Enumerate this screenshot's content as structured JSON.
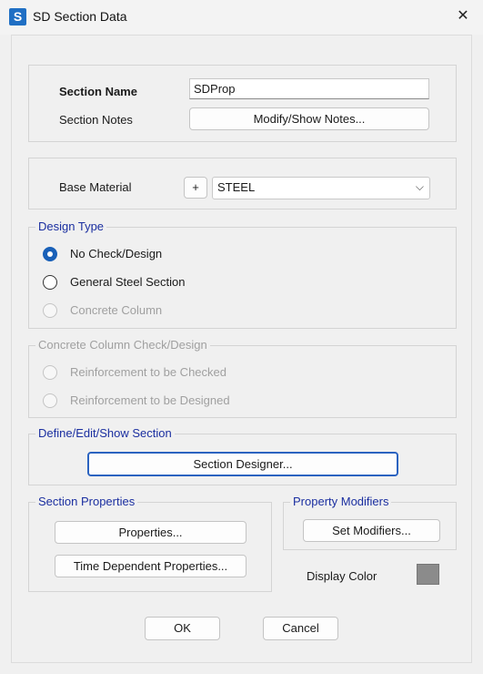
{
  "window": {
    "title": "SD Section Data",
    "app_icon_letter": "S",
    "close_glyph": "✕"
  },
  "section": {
    "name_label": "Section Name",
    "name_value": "SDProp",
    "notes_label": "Section Notes",
    "notes_button": "Modify/Show Notes..."
  },
  "material": {
    "label": "Base Material",
    "add_button": "+",
    "selected": "STEEL"
  },
  "design_type": {
    "title": "Design Type",
    "options": [
      {
        "label": "No Check/Design",
        "state": "checked"
      },
      {
        "label": "General Steel Section",
        "state": "unchecked"
      },
      {
        "label": "Concrete Column",
        "state": "disabled"
      }
    ]
  },
  "concrete_check": {
    "title": "Concrete Column Check/Design",
    "options": [
      {
        "label": "Reinforcement to be Checked",
        "state": "disabled"
      },
      {
        "label": "Reinforcement to be Designed",
        "state": "disabled"
      }
    ]
  },
  "define_section": {
    "title": "Define/Edit/Show Section",
    "button": "Section Designer..."
  },
  "section_properties": {
    "title": "Section Properties",
    "properties_button": "Properties...",
    "time_dependent_button": "Time Dependent Properties..."
  },
  "property_modifiers": {
    "title": "Property Modifiers",
    "button": "Set Modifiers..."
  },
  "display_color": {
    "label": "Display Color",
    "color": "#8b8b8b"
  },
  "footer": {
    "ok": "OK",
    "cancel": "Cancel"
  },
  "colors": {
    "accent": "#1960b8",
    "group_title": "#1b2fa0",
    "disabled_text": "#a0a0a0"
  }
}
